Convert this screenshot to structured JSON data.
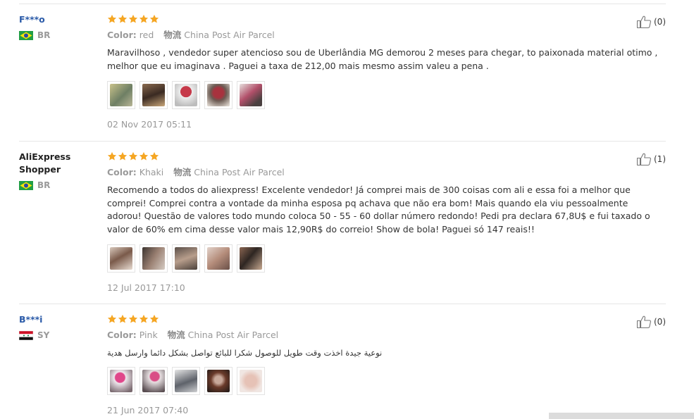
{
  "reviews": [
    {
      "user": "F***o",
      "country": "BR",
      "rating": 5,
      "color_label": "Color:",
      "color": "red",
      "ship_label": "物流",
      "shipping": "China Post Air Parcel",
      "text": "Maravilhoso , vendedor super atencioso sou de Uberlândia MG demorou 2 meses para chegar, to paixonada material otimo , melhor que eu imaginava . Paguei a taxa de 212,00 mais mesmo assim valeu a pena .",
      "photos": 5,
      "date": "02 Nov 2017 05:11",
      "helpful_count": "(0)"
    },
    {
      "user": "AliExpress Shopper",
      "country": "BR",
      "rating": 5,
      "color_label": "Color:",
      "color": "Khaki",
      "ship_label": "物流",
      "shipping": "China Post Air Parcel",
      "text": "Recomendo a todos do aliexpress! Excelente vendedor! Já comprei mais de 300 coisas com ali e essa foi a melhor que comprei! Comprei contra a vontade da minha esposa pq achava que não era bom! Mais quando ela viu pessoalmente adorou! Questão de valores todo mundo coloca 50 - 55 - 60 dollar número redondo! Pedi pra declara 67,8U$ e fui taxado o valor de 60% em cima desse valor mais 12,90R$ do correio! Show de bola! Paguei só 147 reais!!",
      "photos": 5,
      "date": "12 Jul 2017 17:10",
      "helpful_count": "(1)"
    },
    {
      "user": "B***i",
      "country": "SY",
      "rating": 5,
      "color_label": "Color:",
      "color": "Pink",
      "ship_label": "物流",
      "shipping": "China Post Air Parcel",
      "text": "نوعية جيدة اخذت وقت طويل للوصول شكرا للبائع تواصل بشكل دائما وارسل هدية",
      "photos": 5,
      "date": "21 Jun 2017 07:40",
      "helpful_count": "(0)"
    }
  ],
  "colors": {
    "star": "#f5a623",
    "link": "#2a5aa8",
    "muted": "#999999"
  },
  "icons": {
    "star": "star-icon",
    "helpful": "thumbs-up-icon",
    "flag_br": "brazil-flag-icon",
    "flag_sy": "syria-flag-icon"
  }
}
